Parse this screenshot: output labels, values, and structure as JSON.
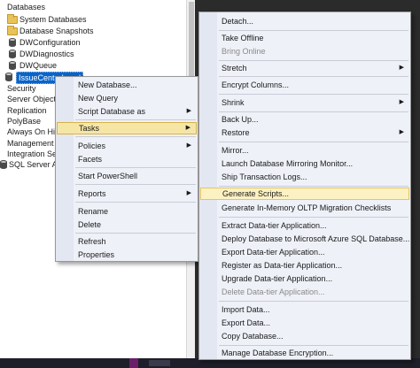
{
  "tree": {
    "items": [
      {
        "label": "Databases",
        "icon": "none"
      },
      {
        "label": "System Databases",
        "icon": "folder-icon"
      },
      {
        "label": "Database Snapshots",
        "icon": "folder-icon"
      },
      {
        "label": "DWConfiguration",
        "icon": "database-icon"
      },
      {
        "label": "DWDiagnostics",
        "icon": "database-icon"
      },
      {
        "label": "DWQueue",
        "icon": "database-icon"
      },
      {
        "label": "IssueCenterLocal",
        "icon": "database-icon",
        "selected": true
      },
      {
        "label": "Security",
        "icon": "none"
      },
      {
        "label": "Server Objects",
        "icon": "none"
      },
      {
        "label": "Replication",
        "icon": "none"
      },
      {
        "label": "PolyBase",
        "icon": "none"
      },
      {
        "label": "Always On Hig",
        "icon": "none"
      },
      {
        "label": "Management",
        "icon": "none"
      },
      {
        "label": "Integration Ser",
        "icon": "none"
      },
      {
        "label": "SQL Server Age",
        "icon": "none"
      }
    ]
  },
  "db_menu": {
    "items": [
      {
        "label": "New Database...",
        "submenu": false
      },
      {
        "label": "New Query",
        "submenu": false
      },
      {
        "label": "Script Database as",
        "submenu": true
      },
      {
        "label": "Tasks",
        "submenu": true,
        "selected": true
      },
      {
        "label": "Policies",
        "submenu": true
      },
      {
        "label": "Facets",
        "submenu": false
      },
      {
        "label": "Start PowerShell",
        "submenu": false
      },
      {
        "label": "Reports",
        "submenu": true
      },
      {
        "label": "Rename",
        "submenu": false
      },
      {
        "label": "Delete",
        "submenu": false
      },
      {
        "label": "Refresh",
        "submenu": false
      },
      {
        "label": "Properties",
        "submenu": false
      }
    ]
  },
  "tasks_menu": {
    "items": [
      {
        "label": "Detach...",
        "disabled": false
      },
      {
        "label": "Take Offline",
        "disabled": false
      },
      {
        "label": "Bring Online",
        "disabled": true
      },
      {
        "label": "Stretch",
        "disabled": false,
        "submenu": true
      },
      {
        "label": "Encrypt Columns...",
        "disabled": false
      },
      {
        "label": "Shrink",
        "disabled": false,
        "submenu": true
      },
      {
        "label": "Back Up...",
        "disabled": false
      },
      {
        "label": "Restore",
        "disabled": false,
        "submenu": true
      },
      {
        "label": "Mirror...",
        "disabled": false
      },
      {
        "label": "Launch Database Mirroring Monitor...",
        "disabled": false
      },
      {
        "label": "Ship Transaction Logs...",
        "disabled": false
      },
      {
        "label": "Generate Scripts...",
        "disabled": false,
        "highlighted": true
      },
      {
        "label": "Generate In-Memory OLTP Migration Checklists",
        "disabled": false
      },
      {
        "label": "Extract Data-tier Application...",
        "disabled": false
      },
      {
        "label": "Deploy Database to Microsoft Azure SQL Database...",
        "disabled": false
      },
      {
        "label": "Export Data-tier Application...",
        "disabled": false
      },
      {
        "label": "Register as Data-tier Application...",
        "disabled": false
      },
      {
        "label": "Upgrade Data-tier Application...",
        "disabled": false
      },
      {
        "label": "Delete Data-tier Application...",
        "disabled": true
      },
      {
        "label": "Import Data...",
        "disabled": false
      },
      {
        "label": "Export Data...",
        "disabled": false
      },
      {
        "label": "Copy Database...",
        "disabled": false
      },
      {
        "label": "Manage Database Encryption...",
        "disabled": false
      }
    ]
  },
  "colors": {
    "selection": "#0a64c8",
    "menu_bg": "#eef1f8",
    "menu_highlight": "#fcf1c2"
  }
}
